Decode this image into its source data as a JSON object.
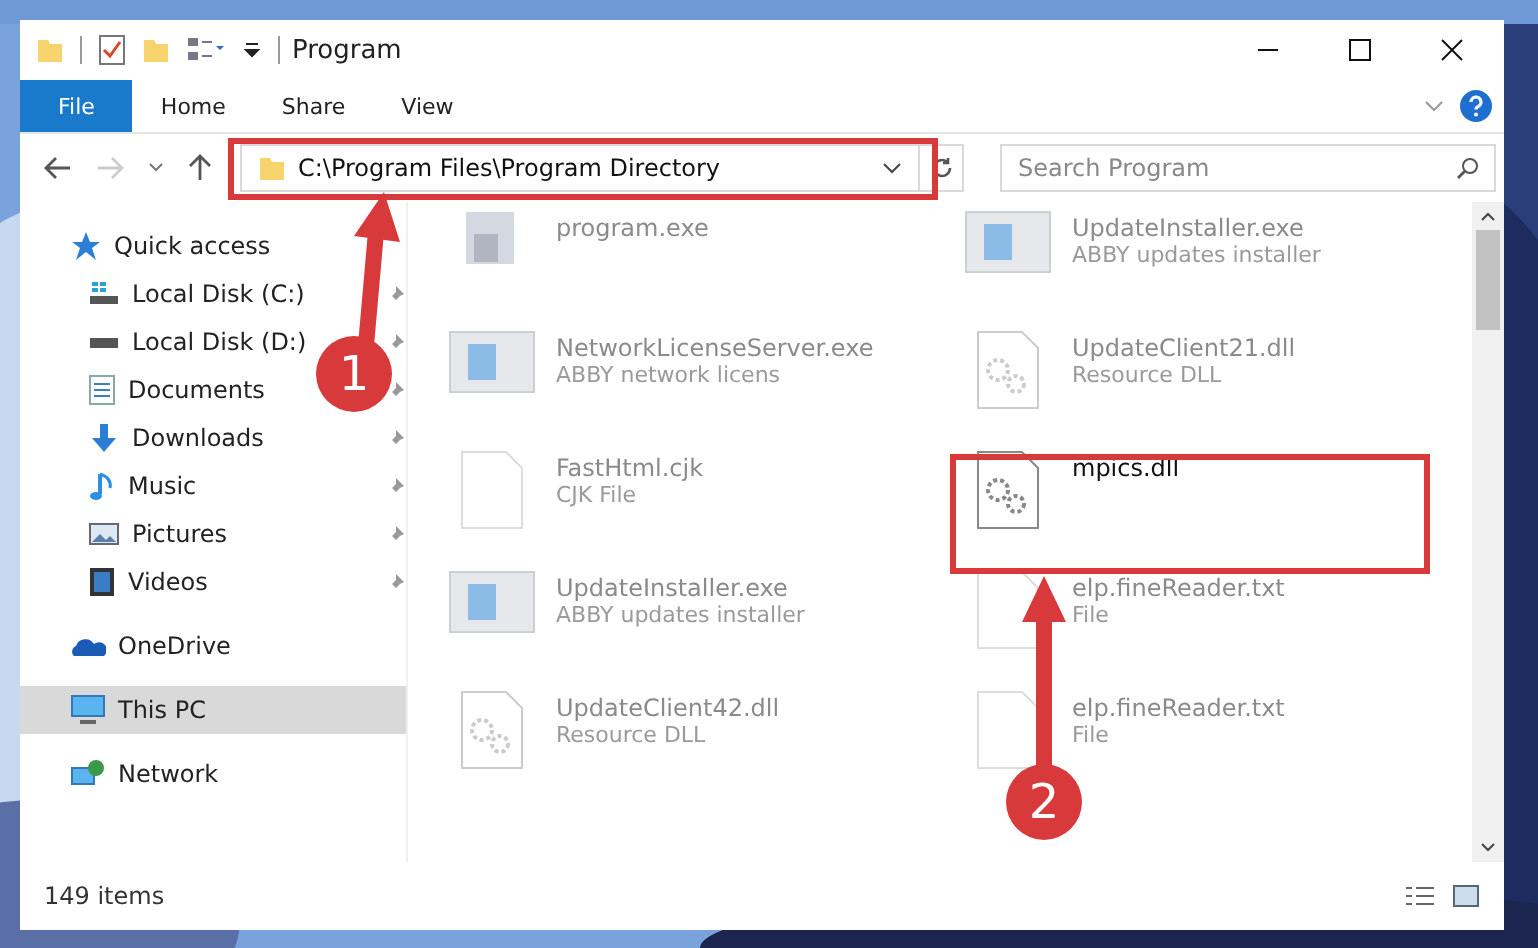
{
  "window": {
    "title": "Program"
  },
  "ribbon_tabs": [
    {
      "label": "File",
      "kind": "menu"
    },
    {
      "label": "Home",
      "kind": "tab"
    },
    {
      "label": "Share",
      "kind": "tab"
    },
    {
      "label": "View",
      "kind": "tab"
    }
  ],
  "address": {
    "path": "C:\\Program Files\\Program Directory"
  },
  "search": {
    "placeholder": "Search Program"
  },
  "sidebar": {
    "items": [
      {
        "label": "Quick access",
        "selected": false,
        "children": [
          {
            "label": "Local Disk (C:)",
            "pinned": true,
            "selected": false
          },
          {
            "label": "Local Disk (D:)",
            "pinned": true,
            "selected": false
          },
          {
            "label": "Documents",
            "pinned": true,
            "selected": false
          },
          {
            "label": "Downloads",
            "pinned": true,
            "selected": false
          },
          {
            "label": "Music",
            "pinned": true,
            "selected": false
          },
          {
            "label": "Pictures",
            "pinned": true,
            "selected": false
          },
          {
            "label": "Videos",
            "pinned": true,
            "selected": false
          }
        ]
      },
      {
        "label": "OneDrive",
        "selected": false
      },
      {
        "label": "This PC",
        "selected": true
      },
      {
        "label": "Network",
        "selected": false
      }
    ]
  },
  "files": [
    {
      "name": "program.exe",
      "kind": "program",
      "faded": true
    },
    {
      "name": "UpdateInstaller.exe",
      "type": "ABBY updates installer",
      "kind": "window",
      "faded": true
    },
    {
      "name": "NetworkLicenseServer.exe",
      "type": "ABBY network licens",
      "kind": "window",
      "faded": true
    },
    {
      "name": "UpdateClient21.dll",
      "type": "Resource DLL",
      "kind": "dll",
      "faded": true
    },
    {
      "name": "FastHtml.cjk",
      "type": "CJK File",
      "kind": "file",
      "faded": true
    },
    {
      "name": "mpics.dll",
      "kind": "dll",
      "faded": false
    },
    {
      "name": "UpdateInstaller.exe",
      "type": "ABBY updates installer",
      "kind": "window",
      "faded": true
    },
    {
      "name": "elp.fineReader.txt",
      "type": "File",
      "kind": "file",
      "faded": true
    },
    {
      "name": "UpdateClient42.dll",
      "type": "Resource DLL",
      "kind": "dll",
      "faded": true
    },
    {
      "name": "elp.fineReader.txt",
      "type": "File",
      "kind": "file",
      "faded": true
    }
  ],
  "status_bar": {
    "count": "149 items"
  },
  "annotations": [
    {
      "number": "1"
    },
    {
      "number": "2"
    }
  ]
}
